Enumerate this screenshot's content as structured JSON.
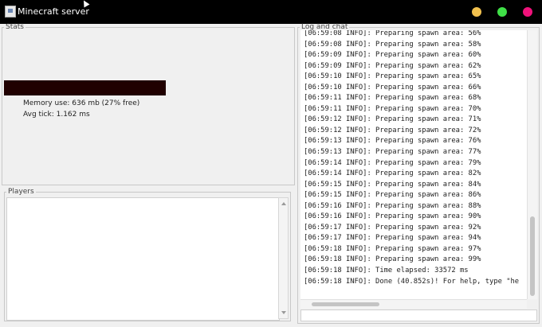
{
  "window": {
    "title": "Minecraft server"
  },
  "stats": {
    "legend": "Stats",
    "memory_text": "Memory use: 636 mb (27% free)",
    "memory_free_fraction": 0.27,
    "avg_tick_text": "Avg tick: 1.162 ms"
  },
  "players": {
    "legend": "Players"
  },
  "log": {
    "legend": "Log and chat",
    "lines": [
      "[06:59:08 INFO]: Preparing spawn area: 56%",
      "[06:59:08 INFO]: Preparing spawn area: 58%",
      "[06:59:09 INFO]: Preparing spawn area: 60%",
      "[06:59:09 INFO]: Preparing spawn area: 62%",
      "[06:59:10 INFO]: Preparing spawn area: 65%",
      "[06:59:10 INFO]: Preparing spawn area: 66%",
      "[06:59:11 INFO]: Preparing spawn area: 68%",
      "[06:59:11 INFO]: Preparing spawn area: 70%",
      "[06:59:12 INFO]: Preparing spawn area: 71%",
      "[06:59:12 INFO]: Preparing spawn area: 72%",
      "[06:59:13 INFO]: Preparing spawn area: 76%",
      "[06:59:13 INFO]: Preparing spawn area: 77%",
      "[06:59:14 INFO]: Preparing spawn area: 79%",
      "[06:59:14 INFO]: Preparing spawn area: 82%",
      "[06:59:15 INFO]: Preparing spawn area: 84%",
      "[06:59:15 INFO]: Preparing spawn area: 86%",
      "[06:59:16 INFO]: Preparing spawn area: 88%",
      "[06:59:16 INFO]: Preparing spawn area: 90%",
      "[06:59:17 INFO]: Preparing spawn area: 92%",
      "[06:59:17 INFO]: Preparing spawn area: 94%",
      "[06:59:18 INFO]: Preparing spawn area: 97%",
      "[06:59:18 INFO]: Preparing spawn area: 99%",
      "[06:59:18 INFO]: Time elapsed: 33572 ms",
      "[06:59:18 INFO]: Done (40.852s)! For help, type \"he"
    ]
  },
  "colors": {
    "titlebar": "#000000",
    "minimize": "#f2c14e",
    "maximize": "#3fe047",
    "close": "#f0127b",
    "memory_bar": "#200000"
  },
  "icons": {
    "app": "java-cup-icon",
    "minimize": "minimize-circle-icon",
    "maximize": "maximize-circle-icon",
    "close": "close-circle-icon"
  }
}
